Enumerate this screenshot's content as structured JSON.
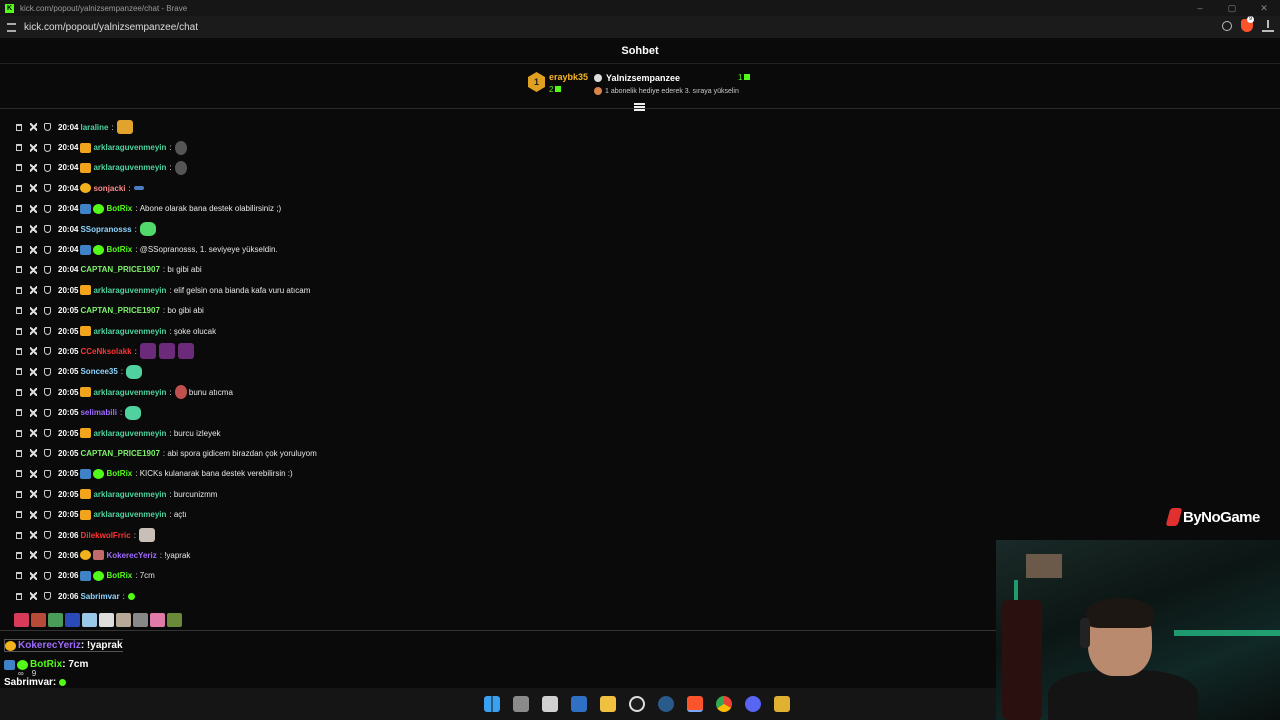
{
  "browser": {
    "window_title": "kick.com/popout/yalnizsempanzee/chat - Brave",
    "url": "kick.com/popout/yalnizsempanzee/chat",
    "brave_badge": "9"
  },
  "chat": {
    "header_title": "Sohbet",
    "pinned": {
      "gifter_badge": "1",
      "gifter": "eraybk35",
      "gifter_count": "2",
      "channel": "Yalnizsempanzee",
      "channel_count": "1",
      "message": "1 abonelik hediye ederek 3. sıraya yükselin"
    },
    "messages": [
      {
        "time": "20:04",
        "user": "laraline",
        "text": ""
      },
      {
        "time": "20:04",
        "user": "arklaraguvenmeyin",
        "text": ""
      },
      {
        "time": "20:04",
        "user": "arklaraguvenmeyin",
        "text": ""
      },
      {
        "time": "20:04",
        "user": "sonjacki",
        "text": ""
      },
      {
        "time": "20:04",
        "user": "BotRix",
        "text": "Abone olarak bana destek olabilirsiniz ;)"
      },
      {
        "time": "20:04",
        "user": "SSopranosss",
        "text": ""
      },
      {
        "time": "20:04",
        "user": "BotRix",
        "text": "@SSopranosss, 1. seviyeye yükseldin."
      },
      {
        "time": "20:04",
        "user": "CAPTAN_PRICE1907",
        "text": "bı gibi abi"
      },
      {
        "time": "20:05",
        "user": "arklaraguvenmeyin",
        "text": "elif gelsin ona bianda kafa vuru atıcam"
      },
      {
        "time": "20:05",
        "user": "CAPTAN_PRICE1907",
        "text": "bo gibi abi"
      },
      {
        "time": "20:05",
        "user": "arklaraguvenmeyin",
        "text": "şoke olucak"
      },
      {
        "time": "20:05",
        "user": "CCeNksolakk",
        "text": ""
      },
      {
        "time": "20:05",
        "user": "Soncee35",
        "text": ""
      },
      {
        "time": "20:05",
        "user": "arklaraguvenmeyin",
        "text": "bunu atıcma"
      },
      {
        "time": "20:05",
        "user": "selimabili",
        "text": ""
      },
      {
        "time": "20:05",
        "user": "arklaraguvenmeyin",
        "text": "burcu izleyek"
      },
      {
        "time": "20:05",
        "user": "CAPTAN_PRICE1907",
        "text": "abi spora gidicem birazdan çok yoruluyom"
      },
      {
        "time": "20:05",
        "user": "BotRix",
        "text": "KICKs kulanarak bana destek verebilirsin :)"
      },
      {
        "time": "20:05",
        "user": "arklaraguvenmeyin",
        "text": "burcunizmm"
      },
      {
        "time": "20:05",
        "user": "arklaraguvenmeyin",
        "text": "açtı"
      },
      {
        "time": "20:06",
        "user": "DilekwolFrric",
        "text": ""
      },
      {
        "time": "20:06",
        "user": "KokerecYeriz",
        "text": "!yaprak"
      },
      {
        "time": "20:06",
        "user": "BotRix",
        "text": "7cm"
      },
      {
        "time": "20:06",
        "user": "Sabrimvar",
        "text": ""
      }
    ]
  },
  "overlay": {
    "line1_user": "KokerecYeriz",
    "line1_text": ": !yaprak",
    "line2_user": "BotRix",
    "line2_text": ": 7cm",
    "line2_sub_a": "∞",
    "line2_sub_b": "9",
    "line3_user": "Sabrimvar",
    "line3_text": " :"
  },
  "watermark": "ByNoGame"
}
